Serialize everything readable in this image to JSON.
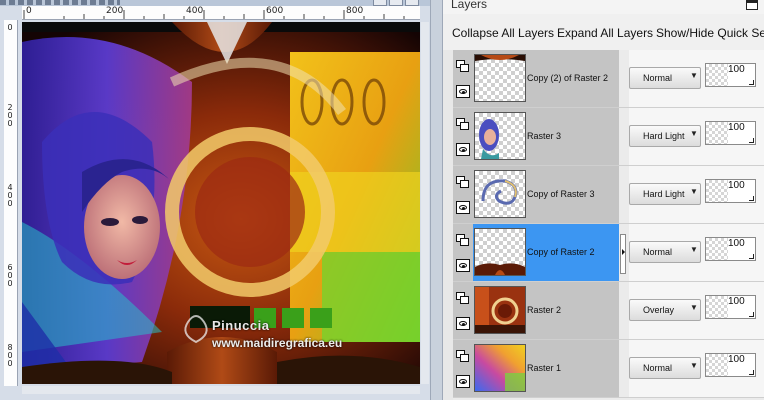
{
  "canvas": {
    "ruler_top_labels": [
      "0",
      "200",
      "400",
      "600",
      "800"
    ],
    "ruler_left_labels": [
      [
        "0"
      ],
      [
        "2",
        "0",
        "0"
      ],
      [
        "4",
        "0",
        "0"
      ],
      [
        "6",
        "0",
        "0"
      ],
      [
        "8",
        "0",
        "0"
      ]
    ],
    "watermark_name": "Pinuccia",
    "watermark_url": "www.maidiregrafica.eu"
  },
  "palette": {
    "title": "Layers",
    "toolbar": {
      "collapse_label": "Collapse All Layers",
      "expand_label": "Expand All Layers",
      "show_hide_label": "Show/Hide Quick Sea"
    },
    "selection_color": "#3c96f2",
    "layers": [
      {
        "name": "Copy (2) of Raster 2",
        "blend_mode": "Normal",
        "opacity": "100",
        "thumbnail": "top-wave",
        "selected": false
      },
      {
        "name": "Raster 3",
        "blend_mode": "Hard Light",
        "opacity": "100",
        "thumbnail": "woman-face",
        "selected": false
      },
      {
        "name": "Copy of Raster 3",
        "blend_mode": "Hard Light",
        "opacity": "100",
        "thumbnail": "swirl",
        "selected": false
      },
      {
        "name": "Copy of Raster 2",
        "blend_mode": "Normal",
        "opacity": "100",
        "thumbnail": "bottom-wave",
        "selected": true
      },
      {
        "name": "Raster 2",
        "blend_mode": "Overlay",
        "opacity": "100",
        "thumbnail": "red-texture",
        "selected": false
      },
      {
        "name": "Raster 1",
        "blend_mode": "Normal",
        "opacity": "100",
        "thumbnail": "rainbow-gradient",
        "selected": false
      }
    ]
  }
}
